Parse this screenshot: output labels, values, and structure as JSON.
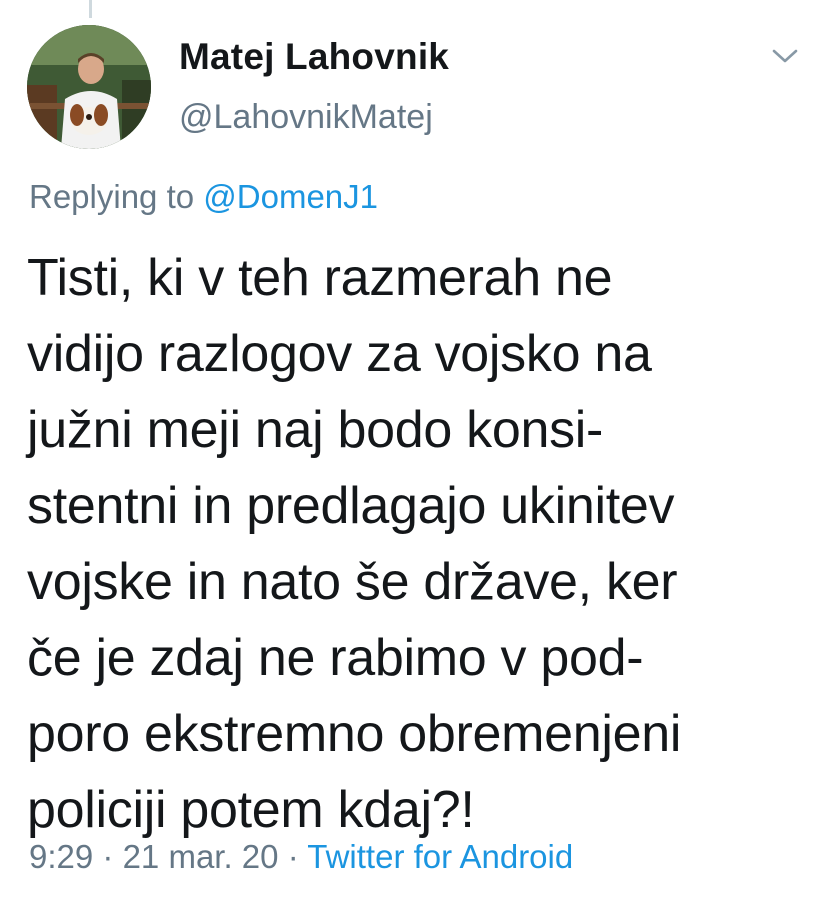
{
  "author": {
    "name": "Matej Lahovnik",
    "handle": "@LahovnikMatej"
  },
  "reply": {
    "prefix": "Replying to",
    "mention": "@DomenJ1"
  },
  "tweet": {
    "lines": [
      "Tisti, ki v teh razmerah ne",
      "vidijo razlogov za vojsko na",
      "južni meji naj bodo konsi-",
      "stentni in predlagajo ukinitev",
      "vojske in nato še države, ker",
      "če je zdaj ne rabimo v pod-",
      "poro ekstremno obremenjeni",
      "policiji potem kdaj?!"
    ]
  },
  "meta": {
    "time": "9:29",
    "separator": "·",
    "date": "21 mar. 20",
    "source": "Twitter for Android"
  },
  "icons": {
    "menu": "chevron-down-icon"
  },
  "colors": {
    "text": "#14171a",
    "secondary": "#657786",
    "link": "#1b95e0",
    "thread_line": "#cfd9de"
  }
}
